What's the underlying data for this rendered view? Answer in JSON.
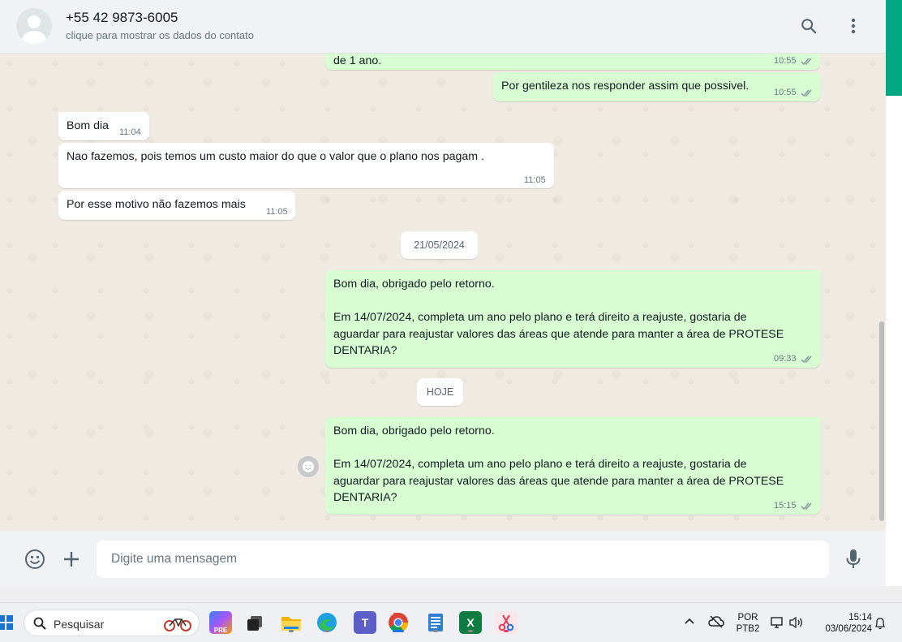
{
  "header": {
    "contact_name": "+55 42 9873-6005",
    "contact_subtitle": "clique para mostrar os dados do contato",
    "search_icon": "search-icon",
    "menu_icon": "more-vertical-icon"
  },
  "chat": {
    "top_partial": {
      "text": "de 1 ano.",
      "time": "10:55"
    },
    "messages": [
      {
        "dir": "out",
        "text": "Por gentileza nos responder assim que possivel.",
        "time": "10:55"
      },
      {
        "dir": "in",
        "text": "Bom dia",
        "time": "11:04"
      },
      {
        "dir": "in",
        "text": "Nao fazemos, pois temos um custo maior do que o valor que o plano nos pagam .",
        "time": "11:05"
      },
      {
        "dir": "in",
        "text": "Por esse motivo não fazemos mais",
        "time": "11:05"
      },
      {
        "dir": "out",
        "text": "Bom dia, obrigado pelo retorno.\n\nEm 14/07/2024, completa um ano pelo plano e terá direito a reajuste, gostaria de\naguardar para reajustar valores das áreas que atende para manter a área de PROTESE\nDENTARIA?",
        "time": "09:33"
      },
      {
        "dir": "out",
        "text": "Bom dia, obrigado pelo retorno.\n\nEm 14/07/2024, completa um ano pelo plano e terá direito a reajuste, gostaria de\naguardar para reajustar valores das áreas que atende para manter a área de PROTESE\nDENTARIA?",
        "time": "15:15"
      }
    ],
    "date_chips": [
      "21/05/2024",
      "HOJE"
    ],
    "colors": {
      "incoming": "#ffffff",
      "outgoing": "#d9fdd3",
      "read_ticks": "#8696a0",
      "accent": "#00a884"
    }
  },
  "composer": {
    "placeholder": "Digite uma mensagem",
    "emoji_icon": "emoji-icon",
    "attach_icon": "plus-icon",
    "mic_icon": "mic-icon"
  },
  "taskbar": {
    "search_placeholder": "Pesquisar",
    "apps": [
      "copilot",
      "task-view",
      "file-explorer",
      "edge",
      "teams",
      "chrome",
      "notepad",
      "excel",
      "snipping-tool"
    ],
    "lang_line1": "POR",
    "lang_line2": "PTB2",
    "time": "15:14",
    "date": "03/06/2024"
  }
}
